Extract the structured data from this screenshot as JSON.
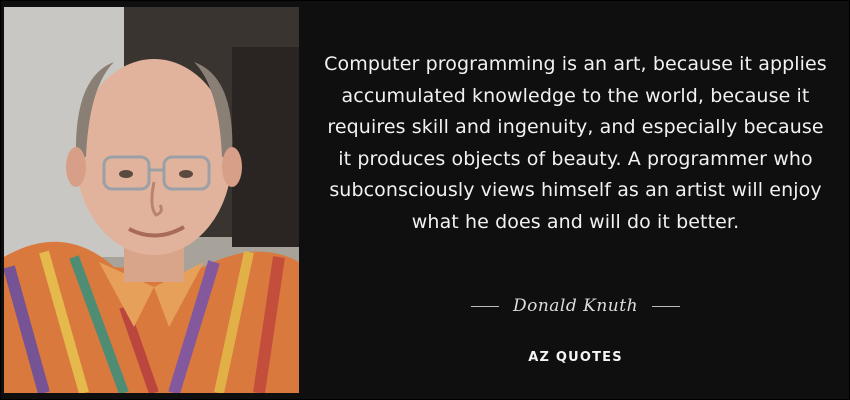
{
  "quote": {
    "text": "Computer programming is an art, because it applies accumulated knowledge to the world, because it requires skill and ingenuity, and especially because it produces objects of beauty. A programmer who subconsciously views himself as an artist will enjoy what he does and will do it better.",
    "author": "Donald Knuth"
  },
  "brand": {
    "logo_text": "AZ QUOTES"
  },
  "colors": {
    "background": "#0f0f0f",
    "quote_text": "#f1f1f1",
    "author_text": "#dcdcdc"
  }
}
